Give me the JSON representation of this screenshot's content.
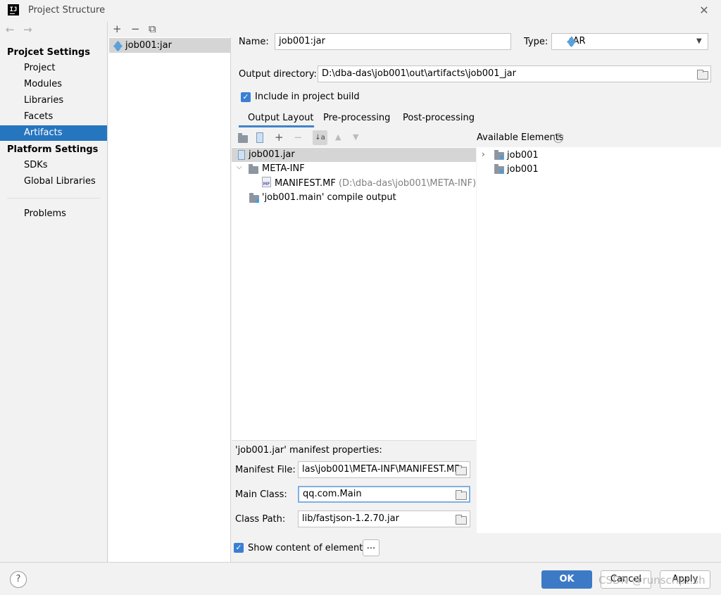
{
  "window": {
    "title": "Project Structure",
    "app_logo": "IJ"
  },
  "nav": {
    "back_icon": "←",
    "forward_icon": "→",
    "project_settings_header": "Projcet Settings",
    "project_items": [
      "Project",
      "Modules",
      "Libraries",
      "Facets",
      "Artifacts"
    ],
    "selected": "Artifacts",
    "platform_settings_header": "Platform Settings",
    "platform_items": [
      "SDKs",
      "Global Libraries"
    ],
    "problems": "Problems"
  },
  "artifacts": {
    "toolbar": {
      "add": "+",
      "remove": "−",
      "copy": "⧉"
    },
    "items": [
      "job001:jar"
    ]
  },
  "artifact": {
    "name_label": "Name:",
    "name_value": "job001:jar",
    "type_label": "Type:",
    "type_value": "JAR",
    "output_dir_label": "Output directory:",
    "output_dir_value": "D:\\dba-das\\job001\\out\\artifacts\\job001_jar",
    "include_build_label": "Include in project build",
    "include_build_checked": true
  },
  "tabs": [
    "Output Layout",
    "Pre-processing",
    "Post-processing"
  ],
  "active_tab": "Output Layout",
  "layout_tree": {
    "root": "job001.jar",
    "meta_inf": "META-INF",
    "manifest_name": "MANIFEST.MF",
    "manifest_path": "(D:\\dba-das\\job001\\META-INF)",
    "compile_output": "'job001.main' compile output"
  },
  "available": {
    "title": "Available Elements",
    "help_icon": "?",
    "items": [
      "job001",
      "job001"
    ]
  },
  "manifest": {
    "title": "'job001.jar' manifest properties:",
    "manifest_file_label": "Manifest File:",
    "manifest_file_value": "las\\job001\\META-INF\\MANIFEST.MF",
    "main_class_label": "Main Class:",
    "main_class_value": "qq.com.Main",
    "class_path_label": "Class Path:",
    "class_path_value": "lib/fastjson-1.2.70.jar"
  },
  "show_content": {
    "label": "Show content of elements",
    "checked": true,
    "more": "..."
  },
  "footer": {
    "help": "?",
    "ok": "OK",
    "cancel": "Cancel",
    "apply": "Apply"
  },
  "watermark": "CSDN @runscript.sh"
}
